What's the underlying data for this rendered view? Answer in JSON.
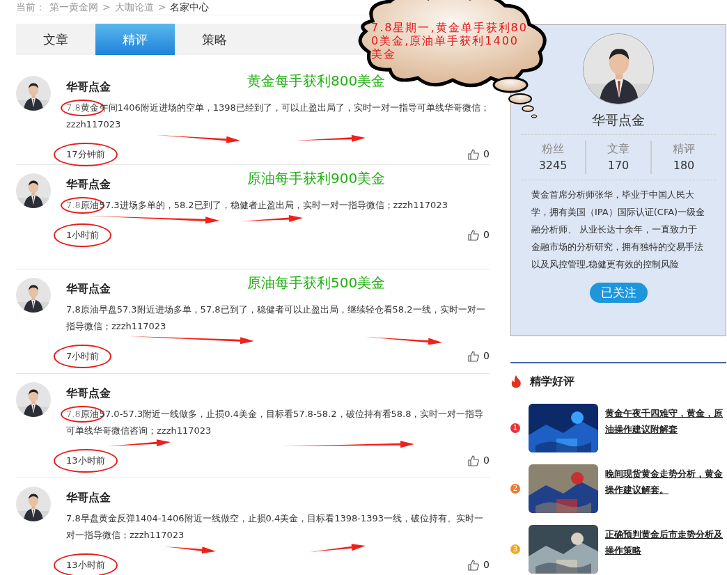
{
  "breadcrumb": {
    "prefix": "当前：",
    "separator": ">",
    "items": [
      "第一黄金网",
      "大咖论道",
      "名家中心"
    ]
  },
  "tabs": [
    {
      "label": "文章",
      "selected": false
    },
    {
      "label": "精评",
      "selected": true
    },
    {
      "label": "策略",
      "selected": false
    }
  ],
  "callout": {
    "text": "7.8星期一,黄金单手获利800美金,原油单手获利1400美金"
  },
  "posts": [
    {
      "author": "华哥点金",
      "annotation": "黄金每手获利800美金",
      "text": "7.8黄金午间1406附近进场的空单，1398已经到了，可以止盈出局了，实时一对一指导可单线华哥微信；zzzh117023",
      "time": "17分钟前",
      "likes": "0",
      "date_circled": true
    },
    {
      "author": "华哥点金",
      "annotation": "原油每手获利900美金",
      "text": "7.8原油57.3进场多单的，58.2已到了，稳健者止盈出局，实时一对一指导微信；zzzh117023",
      "time": "1小时前",
      "likes": "0",
      "date_circled": true
    },
    {
      "author": "华哥点金",
      "annotation": "原油每手获利500美金",
      "text": "7.8原油早盘57.3附近进场多单，57.8已到了，稳健者可以止盈出局，继续轻仓看58.2一线，实时一对一指导微信；zzzh117023",
      "time": "7小时前",
      "likes": "0",
      "date_circled": false
    },
    {
      "author": "华哥点金",
      "text": "7.8原油57.0-57.3附近一线做多，止损0.4美金，目标看57.8-58.2，破位持有看58.8，实时一对一指导可单线华哥微信咨询；zzzh117023",
      "time": "13小时前",
      "likes": "0",
      "date_circled": true
    },
    {
      "author": "华哥点金",
      "text": "7.8早盘黄金反弹1404-1406附近一线做空，止损0.4美金，目标看1398-1393一线，破位持有。实时一对一指导微信；zzzh117023",
      "time": "13小时前",
      "likes": "0",
      "date_circled": false
    }
  ],
  "profile": {
    "name": "华哥点金",
    "stats": [
      {
        "label": "粉丝",
        "value": "3245"
      },
      {
        "label": "文章",
        "value": "170"
      },
      {
        "label": "精评",
        "value": "180"
      }
    ],
    "bio": "黄金首席分析师张华，毕业于中国人民大学，拥有美国（IPA）国际认证(CFA)一级金融分析师、 从业长达十余年，一直致力于金融市场的分析研究，拥有独特的交易手法以及风控管理,稳健更有效的控制风险",
    "follow_button": "已关注"
  },
  "hot": {
    "title": "精学好评",
    "items": [
      {
        "rank": "1",
        "color": "#e8333a",
        "title": "黄金午夜千四难守，黄金，原油操作建议附解套"
      },
      {
        "rank": "2",
        "color": "#f07a2a",
        "title": "晚间现货黄金走势分析，黄金操作建议解套。"
      },
      {
        "rank": "3",
        "color": "#f5a623",
        "title": "正确预判黄金后市走势分析及操作策略"
      }
    ]
  }
}
